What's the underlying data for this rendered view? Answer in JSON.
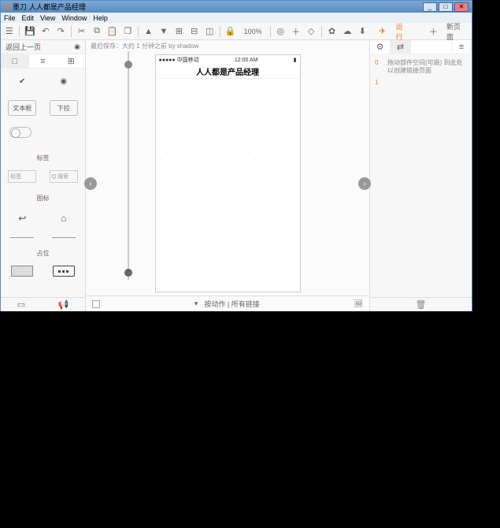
{
  "window": {
    "app_name": "墨刀",
    "title": "人人都是产品经理"
  },
  "menu": {
    "file": "File",
    "edit": "Edit",
    "view": "View",
    "window": "Window",
    "help": "Help"
  },
  "toolbar": {
    "zoom": "100%",
    "publish": "运行",
    "new": "新页面"
  },
  "left": {
    "header": "返回上一页",
    "tabs": [
      "□",
      "≡",
      "⊞"
    ],
    "labels": {
      "section1": "标签",
      "section2": "图标",
      "section3": "占位"
    },
    "btn1": "文本框",
    "btn2": "下拉",
    "input1": "标签",
    "input2": "Q 搜索"
  },
  "center": {
    "info": "最后保存：大约 1 分钟之前 by shadow",
    "status_carrier": "●●●●● 中国移动",
    "status_time": "12:00 AM",
    "status_batt": "▮",
    "nav_title": "人人都是产品经理",
    "foot_select": "按动作 | 所有链接"
  },
  "right": {
    "rows": [
      {
        "idx": "0",
        "txt": "拖动部件空间(可嵌) 到此处以创建链接页面"
      },
      {
        "idx": "1",
        "txt": ""
      }
    ]
  }
}
